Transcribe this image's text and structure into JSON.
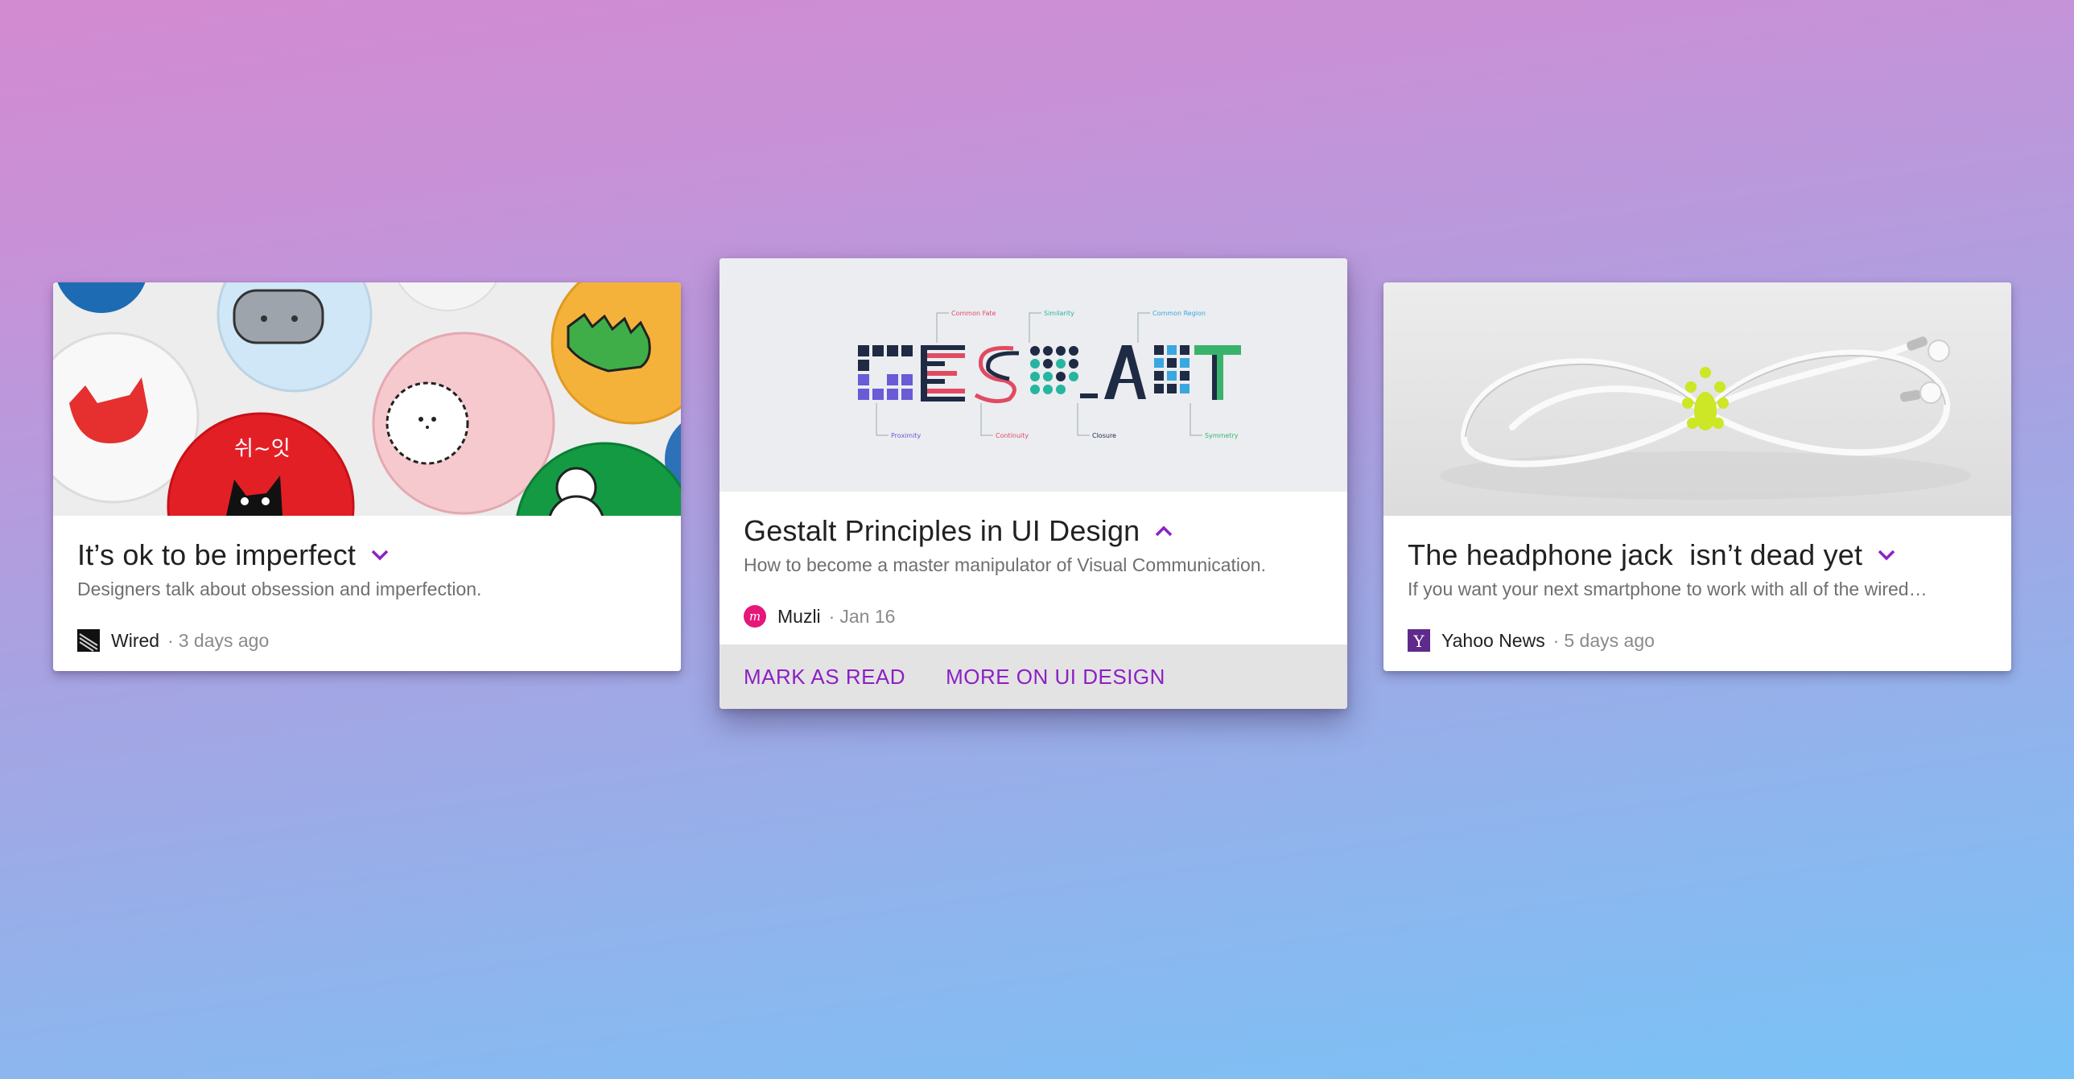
{
  "cards": [
    {
      "title": "It’s ok to be imperfect",
      "subtitle": "Designers talk about obsession and imperfection.",
      "source": "Wired",
      "separator": "·",
      "time": "3 days ago",
      "expand_icon": "chevron-down-icon",
      "image": "colorful-pin-badges"
    },
    {
      "title": "Gestalt Principles in UI Design",
      "subtitle": "How to become a master manipulator of Visual Communication.",
      "source": "Muzli",
      "separator": "·",
      "time": "Jan 16",
      "expand_icon": "chevron-up-icon",
      "image": "gestalt-typography",
      "actions": [
        "MARK AS READ",
        "MORE ON UI DESIGN"
      ],
      "image_labels": {
        "common_fate": "Common Fate",
        "similarity": "Similarity",
        "common_region": "Common Region",
        "proximity": "Proximity",
        "continuity": "Continuity",
        "closure": "Closure",
        "symmetry": "Symmetry"
      }
    },
    {
      "title": "The headphone jack  isn’t dead yet",
      "subtitle": "If you want your next smartphone to work with all of the wired…",
      "source": "Yahoo News",
      "separator": "·",
      "time": "5 days ago",
      "expand_icon": "chevron-down-icon",
      "image": "white-earphones"
    }
  ],
  "colors": {
    "accent": "#8c20c4",
    "title": "#212121",
    "subtitle": "#6f6f6f",
    "action_bar": "#e3e3e3",
    "muzli": "#e5177b",
    "yahoo": "#5f2a8b"
  }
}
